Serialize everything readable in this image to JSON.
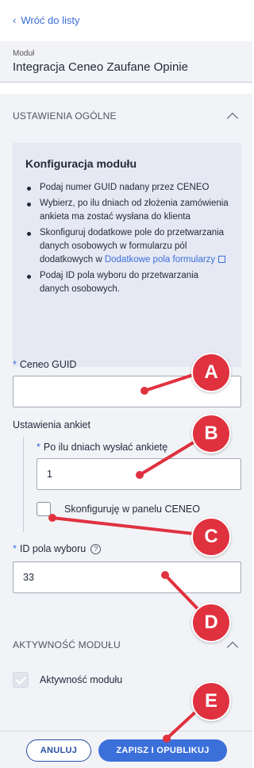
{
  "back_link": "Wróć do listy",
  "module": {
    "caption": "Moduł",
    "name": "Integracja Ceneo Zaufane Opinie"
  },
  "section_general": {
    "title": "USTAWIENIA OGÓLNE"
  },
  "info": {
    "title": "Konfiguracja modułu",
    "items": [
      "Podaj numer GUID nadany przez CENEO",
      "Wybierz, po ilu dniach od złożenia zamówienia ankieta ma zostać wysłana do klienta",
      "Skonfiguruj dodatkowe pole do przetwarzania danych osobowych w formularzu pól dodatkowych w",
      "Podaj ID pola wyboru do przetwarzania danych osobowych."
    ],
    "link_text": "Dodatkowe pola formularzy"
  },
  "fields": {
    "ceneo_guid": {
      "label": "Ceneo GUID",
      "value": ""
    },
    "survey_group_label": "Ustawienia ankiet",
    "survey_days": {
      "label": "Po ilu dniach wysłać ankietę",
      "value": "1"
    },
    "configure_in_panel": {
      "label": "Skonfiguruję w panelu CENEO",
      "checked": false
    },
    "choice_field_id": {
      "label": "ID pola wyboru",
      "value": "33"
    }
  },
  "section_activity": {
    "title": "AKTYWNOŚĆ MODUŁU",
    "checkbox_label": "Aktywność modułu",
    "checked": true
  },
  "buttons": {
    "cancel": "ANULUJ",
    "save": "ZAPISZ I OPUBLIKUJ"
  },
  "markers": [
    "A",
    "B",
    "C",
    "D",
    "E"
  ],
  "colors": {
    "accent": "#3b6fd9",
    "marker": "#e0313f",
    "panel": "#f2f3f7",
    "info_bg": "#e6e9f4"
  }
}
